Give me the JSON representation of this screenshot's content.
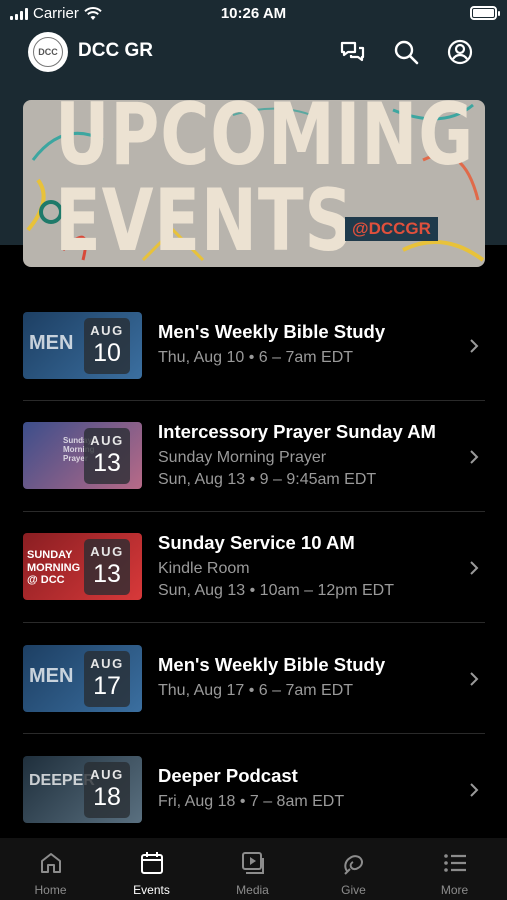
{
  "status_bar": {
    "carrier": "Carrier",
    "time": "10:26 AM"
  },
  "header": {
    "logo_text": "DCC",
    "title": "DCC GR"
  },
  "banner": {
    "line1": "UPCOMING",
    "line2": "EVENTS",
    "tag": "@DCCGR"
  },
  "events": [
    {
      "thumb_text": "MEN",
      "month": "AUG",
      "day": "10",
      "title": "Men's Weekly Bible Study",
      "lines": [
        "Thu, Aug 10 • 6 – 7am EDT"
      ],
      "thumb_colors": [
        "#1d3f63",
        "#3b6fa0"
      ]
    },
    {
      "thumb_text": "Sunday Morning Prayer",
      "month": "AUG",
      "day": "13",
      "title": "Intercessory Prayer Sunday AM",
      "lines": [
        "Sunday Morning Prayer",
        "Sun, Aug 13 • 9 – 9:45am EDT"
      ],
      "thumb_colors": [
        "#3c4e8a",
        "#b86a88"
      ]
    },
    {
      "thumb_text": "SUNDAY MORNING @ DCC",
      "month": "AUG",
      "day": "13",
      "title": "Sunday Service 10 AM",
      "lines": [
        "Kindle Room",
        "Sun, Aug 13 • 10am – 12pm EDT"
      ],
      "thumb_colors": [
        "#8a1e22",
        "#d8393a"
      ]
    },
    {
      "thumb_text": "MEN",
      "month": "AUG",
      "day": "17",
      "title": "Men's Weekly Bible Study",
      "lines": [
        "Thu, Aug 17 • 6 – 7am EDT"
      ],
      "thumb_colors": [
        "#1d3f63",
        "#3b6fa0"
      ]
    },
    {
      "thumb_text": "DEEPER",
      "month": "AUG",
      "day": "18",
      "title": "Deeper Podcast",
      "lines": [
        "Fri, Aug 18 • 7 – 8am EDT"
      ],
      "thumb_colors": [
        "#1f2f3c",
        "#5a7080"
      ]
    }
  ],
  "tabs": [
    {
      "label": "Home",
      "icon": "home-icon"
    },
    {
      "label": "Events",
      "icon": "calendar-icon"
    },
    {
      "label": "Media",
      "icon": "media-icon"
    },
    {
      "label": "Give",
      "icon": "give-icon"
    },
    {
      "label": "More",
      "icon": "more-icon"
    }
  ],
  "colors": {
    "header_bg": "#1b2a32",
    "page_bg": "#000000",
    "accent_tag": "#e0503c",
    "tab_active": "#ffffff",
    "tab_inactive": "#8c8c8c"
  }
}
